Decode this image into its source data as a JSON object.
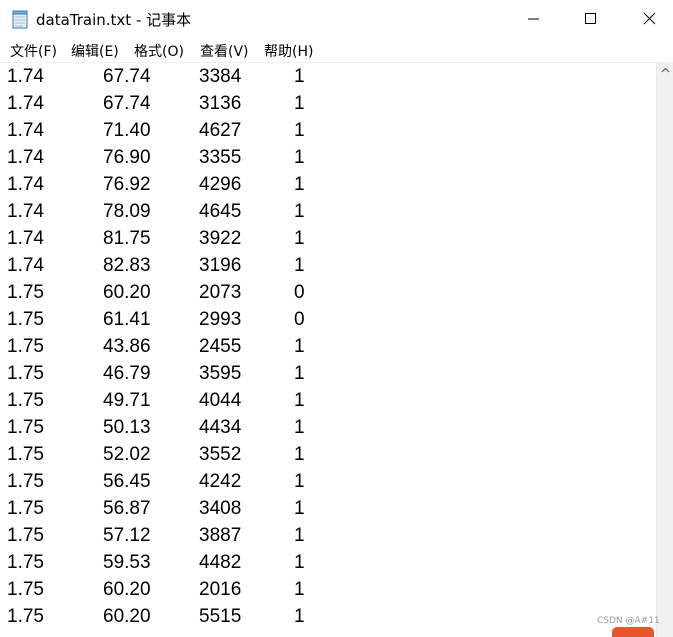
{
  "window": {
    "title": "dataTrain.txt - 记事本",
    "app_icon": "notepad-icon"
  },
  "menu": {
    "items": [
      "文件(F)",
      "编辑(E)",
      "格式(O)",
      "查看(V)",
      "帮助(H)"
    ]
  },
  "content": {
    "rows": [
      [
        "1.74",
        "67.74",
        "3384",
        "1"
      ],
      [
        "1.74",
        "67.74",
        "3136",
        "1"
      ],
      [
        "1.74",
        "71.40",
        "4627",
        "1"
      ],
      [
        "1.74",
        "76.90",
        "3355",
        "1"
      ],
      [
        "1.74",
        "76.92",
        "4296",
        "1"
      ],
      [
        "1.74",
        "78.09",
        "4645",
        "1"
      ],
      [
        "1.74",
        "81.75",
        "3922",
        "1"
      ],
      [
        "1.74",
        "82.83",
        "3196",
        "1"
      ],
      [
        "1.75",
        "60.20",
        "2073",
        "0"
      ],
      [
        "1.75",
        "61.41",
        "2993",
        "0"
      ],
      [
        "1.75",
        "43.86",
        "2455",
        "1"
      ],
      [
        "1.75",
        "46.79",
        "3595",
        "1"
      ],
      [
        "1.75",
        "49.71",
        "4044",
        "1"
      ],
      [
        "1.75",
        "50.13",
        "4434",
        "1"
      ],
      [
        "1.75",
        "52.02",
        "3552",
        "1"
      ],
      [
        "1.75",
        "56.45",
        "4242",
        "1"
      ],
      [
        "1.75",
        "56.87",
        "3408",
        "1"
      ],
      [
        "1.75",
        "57.12",
        "3887",
        "1"
      ],
      [
        "1.75",
        "59.53",
        "4482",
        "1"
      ],
      [
        "1.75",
        "60.20",
        "2016",
        "1"
      ],
      [
        "1.75",
        "60.20",
        "5515",
        "1"
      ]
    ]
  },
  "watermark": {
    "text": "CSDN @A#11"
  },
  "colors": {
    "background": "#ffffff",
    "text": "#000000",
    "scrollbar_track": "#f0f0f0",
    "watermark_logo": "#e8552d"
  }
}
